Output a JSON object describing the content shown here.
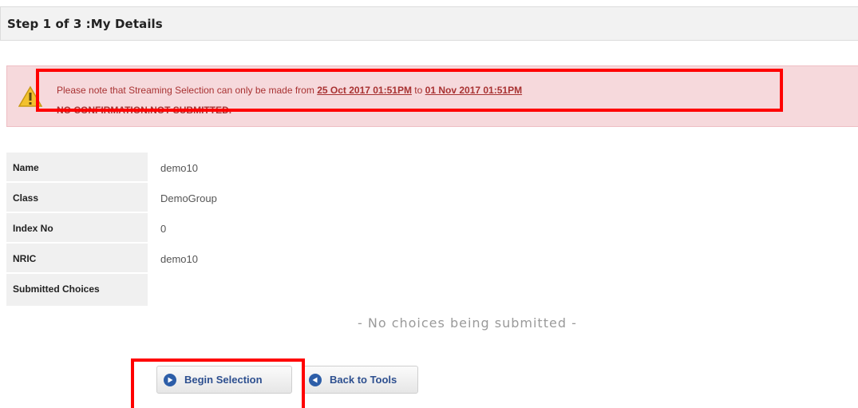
{
  "header": {
    "title": "Step 1 of 3 :My Details"
  },
  "alert": {
    "prefix": "Please note that Streaming Selection can only be made from",
    "start_date": "25 Oct 2017 01:51PM",
    "connector": "to",
    "end_date": "01 Nov 2017 01:51PM",
    "status": "NO CONFIRMATION.NOT SUBMITTED."
  },
  "details": [
    {
      "label": "Name",
      "value": "demo10"
    },
    {
      "label": "Class",
      "value": "DemoGroup"
    },
    {
      "label": "Index No",
      "value": "0"
    },
    {
      "label": "NRIC",
      "value": "demo10"
    },
    {
      "label": "Submitted Choices",
      "value": ""
    }
  ],
  "submitted_empty_message": "- No choices being submitted -",
  "buttons": {
    "begin": "Begin Selection",
    "back": "Back to Tools"
  },
  "colors": {
    "alert_bg": "#f6d9dc",
    "alert_text": "#a83232",
    "highlight": "#ff0000",
    "button_icon": "#2d5ea8"
  }
}
